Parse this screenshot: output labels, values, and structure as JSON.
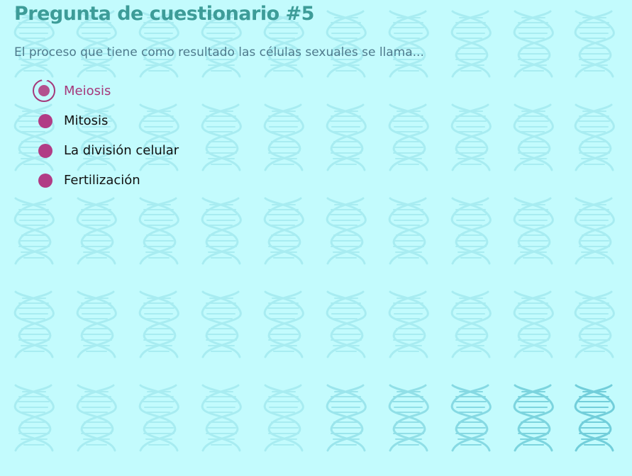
{
  "quiz": {
    "title": "Pregunta de cuestionario #5",
    "question": "El proceso que tiene como resultado las células sexuales se llama...",
    "options": [
      {
        "label": "Meiosis",
        "selected": true
      },
      {
        "label": "Mitosis",
        "selected": false
      },
      {
        "label": "La división celular",
        "selected": false
      },
      {
        "label": "Fertilización",
        "selected": false
      }
    ]
  },
  "colors": {
    "background": "#c3fbfd",
    "title": "#3d9c98",
    "question": "#4e7a8c",
    "radio": "#b13c85",
    "selected": "#a5387a",
    "helix_light": "#9fe8ee",
    "helix_dark": "#6ccbd8"
  },
  "background_pattern": {
    "icon": "dna-helix-icon"
  }
}
